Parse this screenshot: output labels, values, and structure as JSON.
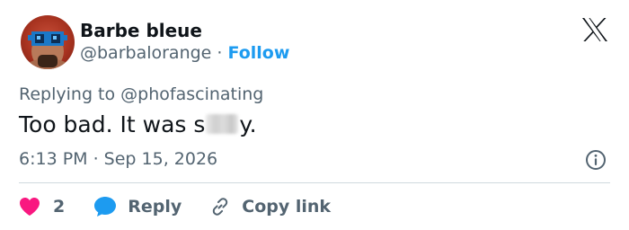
{
  "author": {
    "name": "Barbe bleue",
    "handle": "@barbalorange",
    "separator": "·",
    "follow_label": "Follow"
  },
  "reply_context": {
    "prefix": "Replying to",
    "mention": "@phofascinating"
  },
  "tweet": {
    "text_before": "Too bad. It was s",
    "text_after": "y.",
    "timestamp": "6:13 PM · Sep 15, 2026"
  },
  "actions": {
    "like_count": "2",
    "reply_label": "Reply",
    "copy_link_label": "Copy link"
  },
  "colors": {
    "accent": "#1d9bf0",
    "like": "#f91880",
    "secondary_text": "#536471",
    "primary_text": "#0f1419",
    "divider": "#cfd9de"
  },
  "icons": {
    "brand": "x-logo-icon",
    "info": "info-icon",
    "like": "heart-icon",
    "reply": "speech-bubble-icon",
    "copy_link": "link-icon"
  }
}
